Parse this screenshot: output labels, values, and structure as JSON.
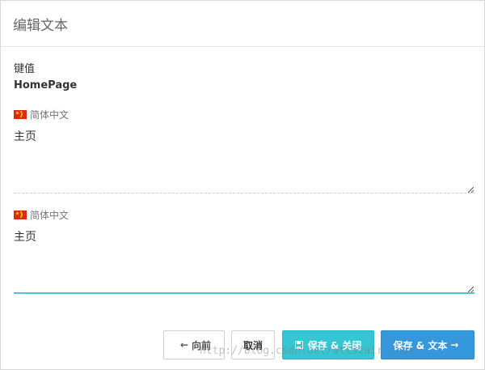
{
  "dialog": {
    "title": "编辑文本",
    "key_label": "键值",
    "key_value": "HomePage"
  },
  "translations": [
    {
      "language": "简体中文",
      "flag": "china-flag-icon",
      "value": "主页"
    },
    {
      "language": "简体中文",
      "flag": "china-flag-icon",
      "value": "主页"
    }
  ],
  "footer": {
    "prev_arrow": "←",
    "prev_label": "向前",
    "cancel_label": "取消",
    "save_close_label": "保存 & 关闭",
    "save_text_label": "保存 & 文本",
    "save_text_arrow": "→"
  },
  "watermark": "http://blog.csdn.net/atlstair_chow",
  "colors": {
    "save_close_bg": "#36c6d3",
    "save_text_bg": "#3598dc",
    "focus_border": "#4fc4cf"
  }
}
